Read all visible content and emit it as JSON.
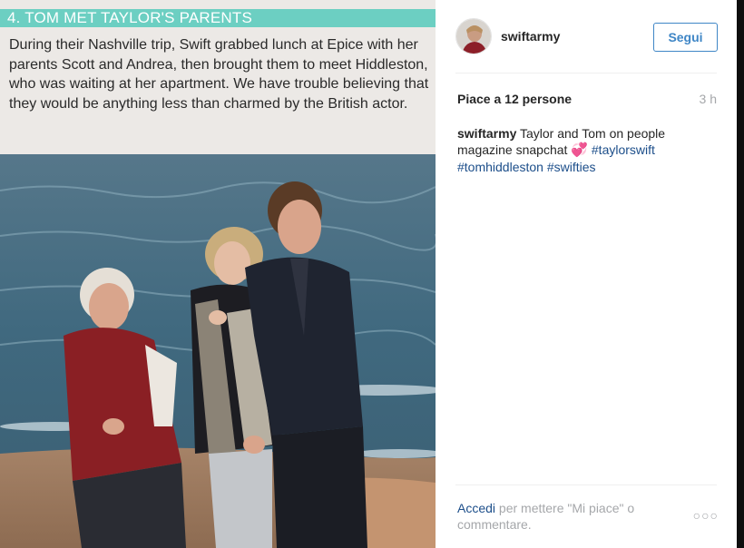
{
  "article": {
    "headline": "4. TOM MET TAYLOR'S PARENTS",
    "body": "During their Nashville trip, Swift grabbed lunch at Epice with her parents Scott and Andrea, then brought them to meet Hiddleston, who was waiting at her apartment. We have trouble believing that they would be anything less than charmed by the British actor."
  },
  "colors": {
    "headline_bar": "#6ccfc2",
    "follow_blue": "#3f86c6",
    "link_blue": "#1c4e8a",
    "muted_gray": "#a5a7aa"
  },
  "post": {
    "username": "swiftarmy",
    "follow_label": "Segui",
    "likes_text": "Piace a 12 persone",
    "time": "3 h",
    "caption": {
      "user": "swiftarmy",
      "text": "Taylor and Tom on people magazine snapchat",
      "emoji": "💞",
      "hashtags": [
        "#taylorswift",
        "#tomhiddleston",
        "#swifties"
      ]
    },
    "footer": {
      "login_link": "Accedi",
      "text": "per mettere \"Mi piace\" o commentare."
    },
    "more_icon": "more-options-icon",
    "more_glyph": "○○○"
  }
}
